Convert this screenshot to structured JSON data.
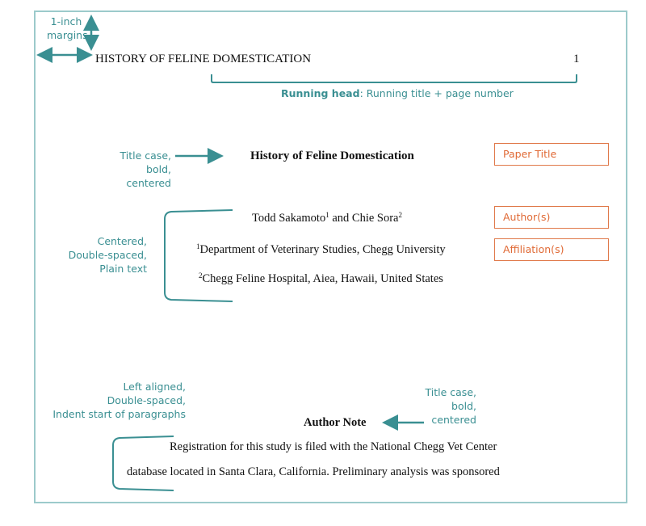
{
  "annotations": {
    "margins": [
      "1-inch",
      "margins"
    ],
    "running_head_label": "Running head",
    "running_head_desc": ": Running title + page number",
    "title_style": [
      "Title case,",
      "bold,",
      "centered"
    ],
    "author_block_style": [
      "Centered,",
      "Double-spaced,",
      "Plain text"
    ],
    "paragraph_style": [
      "Left aligned,",
      "Double-spaced,",
      "Indent start of paragraphs"
    ],
    "author_note_style": [
      "Title case,",
      "bold,",
      "centered"
    ]
  },
  "labels": {
    "paper_title": "Paper Title",
    "authors": "Author(s)",
    "affiliations": "Affiliation(s)"
  },
  "document": {
    "running_head": "HISTORY OF FELINE DOMESTICATION",
    "page_number": "1",
    "title": "History of Feline Domestication",
    "author1": "Todd Sakamoto",
    "author1_sup": "1",
    "author_joiner": " and ",
    "author2": "Chie Sora",
    "author2_sup": "2",
    "affiliation1_sup": "1",
    "affiliation1": "Department of Veterinary Studies, Chegg University",
    "affiliation2_sup": "2",
    "affiliation2": "Chegg Feline Hospital, Aiea, Hawaii, United States",
    "author_note_heading": "Author Note",
    "author_note_line1": "Registration for this study is filed with the National Chegg Vet Center",
    "author_note_line2": "database located in Santa Clara, California. Preliminary analysis was sponsored"
  },
  "colors": {
    "annotation": "#3a8f92",
    "label_box": "#e0794a",
    "page_border": "#9ccacb"
  }
}
